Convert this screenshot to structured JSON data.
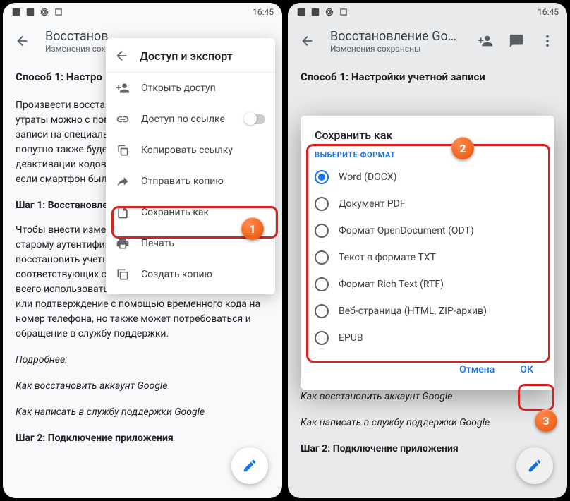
{
  "status": {
    "time": "16:45"
  },
  "appbar": {
    "title_left": "Восстанов",
    "title_right": "Восстановление Googl...",
    "subtitle": "Изменения сохранены"
  },
  "doc": {
    "h1": "Способ 1: Настройки учетной записи",
    "h1_trunc": "Способ 1: Настро",
    "p1": "Произвести восстан",
    "p1_full_a": "утраты можно с помо",
    "p1_full_b": "записи на специальн",
    "p1_full_c": "попутно также будет",
    "p1_full_d": "деактивации кодов",
    "p1_full_e": "если смартфон был",
    "step1": "Шаг 1: Восстановле",
    "p2a": "Чтобы внести измене",
    "p2b": "старому аутентифик",
    "p2c": "восстановить учетн",
    "p2d": "соответствующих с",
    "p2e": "всего использовать для этих целей аварийные коды или подтверждение с помощью временного кода на номер телефона, но также может потребоваться и обращение в службу поддержки.",
    "more": "Подробнее:",
    "link1": "Как восстановить аккаунт Google",
    "link2": "Как написать в службу поддержки Google",
    "step2": "Шаг 2: Подключение приложения"
  },
  "menu": {
    "header": "Доступ и экспорт",
    "items": [
      {
        "icon": "person-add",
        "label": "Открыть доступ"
      },
      {
        "icon": "link",
        "label": "Доступ по ссылке",
        "toggle": true
      },
      {
        "icon": "copy",
        "label": "Копировать ссылку"
      },
      {
        "icon": "send",
        "label": "Отправить копию"
      },
      {
        "icon": "save",
        "label": "Сохранить как"
      },
      {
        "icon": "print",
        "label": "Печать"
      },
      {
        "icon": "duplicate",
        "label": "Создать копию"
      }
    ]
  },
  "dialog": {
    "title": "Сохранить как",
    "section": "ВЫБЕРИТЕ ФОРМАТ",
    "options": [
      "Word (DOCX)",
      "Документ PDF",
      "Формат OpenDocument (ODT)",
      "Текст в формате TXT",
      "Формат Rich Text (RTF)",
      "Веб-страница (HTML, ZIP-архив)",
      "EPUB"
    ],
    "selected": 0,
    "cancel": "Отмена",
    "ok": "ОК"
  },
  "callouts": {
    "n1": "1",
    "n2": "2",
    "n3": "3"
  }
}
